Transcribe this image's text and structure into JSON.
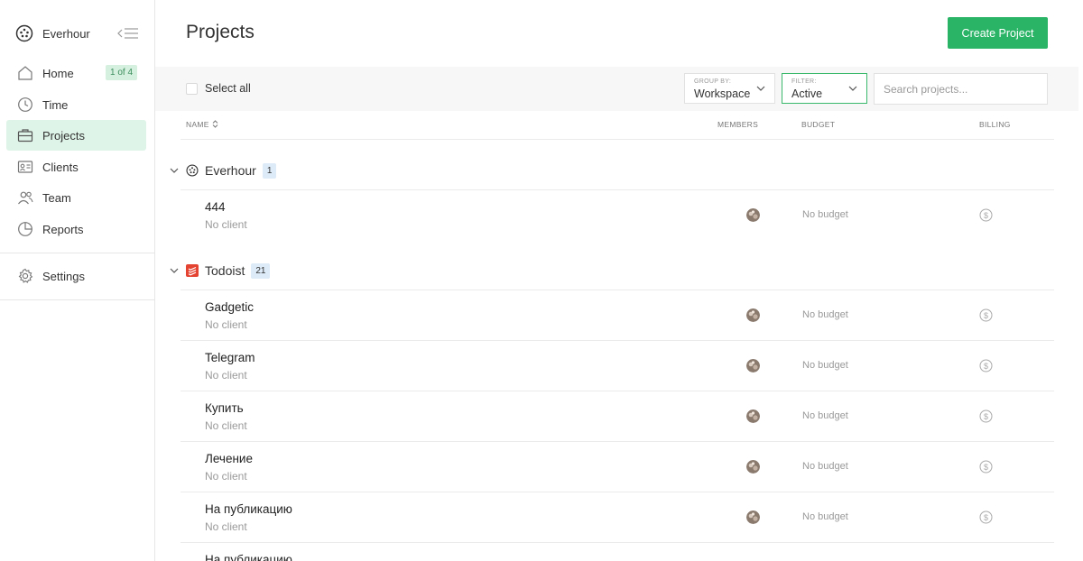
{
  "sidebar": {
    "brand": "Everhour",
    "items": [
      {
        "label": "Home",
        "badge": "1 of 4",
        "icon": "home-icon"
      },
      {
        "label": "Time",
        "icon": "clock-icon"
      },
      {
        "label": "Projects",
        "icon": "briefcase-icon",
        "active": true
      },
      {
        "label": "Clients",
        "icon": "contact-card-icon"
      },
      {
        "label": "Team",
        "icon": "people-icon"
      },
      {
        "label": "Reports",
        "icon": "pie-chart-icon"
      },
      {
        "label": "Settings",
        "icon": "gear-icon"
      }
    ]
  },
  "header": {
    "title": "Projects",
    "create_label": "Create Project"
  },
  "toolbar": {
    "select_all": "Select all",
    "group_by_caption": "GROUP BY:",
    "group_by_value": "Workspace",
    "filter_caption": "FILTER:",
    "filter_value": "Active",
    "search_placeholder": "Search projects..."
  },
  "columns": {
    "name": "NAME",
    "members": "MEMBERS",
    "budget": "BUDGET",
    "billing": "BILLING"
  },
  "groups": [
    {
      "name": "Everhour",
      "count": "1",
      "icon": "everhour-logo-icon",
      "projects": [
        {
          "name": "444",
          "client": "No client",
          "budget": "No budget"
        }
      ]
    },
    {
      "name": "Todoist",
      "count": "21",
      "icon": "todoist-logo-icon",
      "projects": [
        {
          "name": "Gadgetic",
          "client": "No client",
          "budget": "No budget"
        },
        {
          "name": "Telegram",
          "client": "No client",
          "budget": "No budget"
        },
        {
          "name": "Купить",
          "client": "No client",
          "budget": "No budget"
        },
        {
          "name": "Лечение",
          "client": "No client",
          "budget": "No budget"
        },
        {
          "name": "На публикацию",
          "client": "No client",
          "budget": "No budget"
        },
        {
          "name": "На публикацию",
          "client": "",
          "budget": ""
        }
      ]
    }
  ],
  "colors": {
    "accent": "#29b466",
    "active_nav": "#dff4e8",
    "badge_blue": "#dcebf7",
    "todoist_red": "#e44332"
  }
}
